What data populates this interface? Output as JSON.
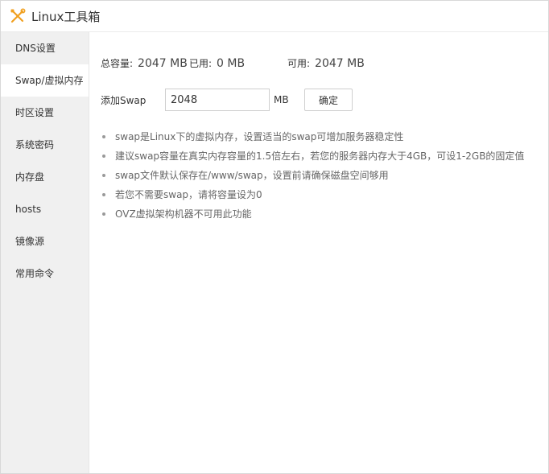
{
  "titlebar": {
    "title": "Linux工具箱",
    "icon": "tools-icon"
  },
  "sidebar": {
    "active_index": 1,
    "items": [
      {
        "label": "DNS设置"
      },
      {
        "label": "Swap/虚拟内存"
      },
      {
        "label": "时区设置"
      },
      {
        "label": "系统密码"
      },
      {
        "label": "内存盘"
      },
      {
        "label": "hosts"
      },
      {
        "label": "镜像源"
      },
      {
        "label": "常用命令"
      }
    ]
  },
  "stats": {
    "total_label": "总容量:",
    "total_value": "2047 MB",
    "used_label": "已用:",
    "used_value": "0 MB",
    "available_label": "可用:",
    "available_value": "2047 MB"
  },
  "add_swap": {
    "label": "添加Swap",
    "value": "2048",
    "unit": "MB",
    "confirm_label": "确定"
  },
  "tips": [
    "swap是Linux下的虚拟内存，设置适当的swap可增加服务器稳定性",
    "建议swap容量在真实内存容量的1.5倍左右，若您的服务器内存大于4GB，可设1-2GB的固定值",
    "swap文件默认保存在/www/swap，设置前请确保磁盘空间够用",
    "若您不需要swap，请将容量设为0",
    "OVZ虚拟架构机器不可用此功能"
  ],
  "colors": {
    "sidebar_bg": "#f0f0f0",
    "active_bg": "#ffffff",
    "icon_orange": "#f0a020"
  }
}
